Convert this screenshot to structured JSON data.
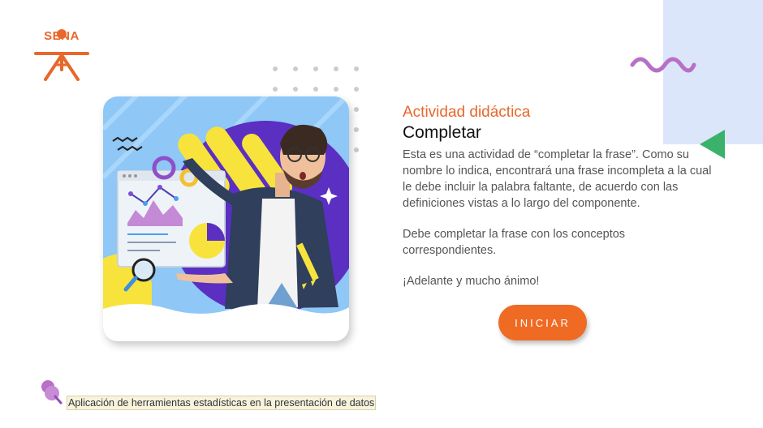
{
  "logo": {
    "text": "SENA",
    "color": "#e8672a"
  },
  "activity": {
    "subtitle": "Actividad didáctica",
    "title": "Completar",
    "paragraphs": [
      "Esta es una actividad de “completar la frase”. Como su nombre lo indica, encontrará una frase incompleta a la cual le debe incluir la palabra faltante, de acuerdo con las definiciones vistas a lo largo del componente.",
      "Debe completar la frase con los conceptos correspondientes.",
      "¡Adelante y mucho ánimo!"
    ]
  },
  "start_button": {
    "label": "INICIAR",
    "color": "#ef6a23"
  },
  "footer": {
    "course_title": "Aplicación de herramientas estadísticas en la presentación de datos"
  },
  "decor": {
    "blue_panel": "#dce6fb",
    "wave_color": "#b86fc6",
    "triangle_color": "#3ab26b",
    "dot_color": "#cccccc"
  },
  "icons": {
    "logo": "sena-logo-icon",
    "illustration": "man-presenting-chart-illustration",
    "course": "pushpin-icon"
  }
}
